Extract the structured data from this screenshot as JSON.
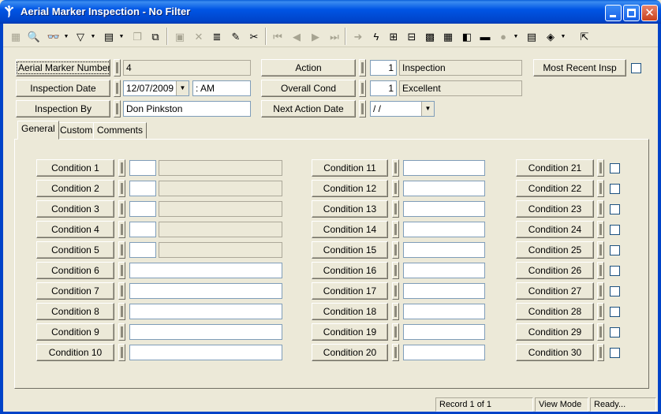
{
  "window": {
    "title": "Aerial Marker Inspection - No Filter"
  },
  "toolbar": {
    "icons": [
      "grid-icon",
      "preview-icon",
      "binoculars-icon",
      "filter-icon",
      "report-icon",
      "copy-icon",
      "export-icon",
      "save-icon",
      "delete-icon",
      "stack-icon",
      "edit-pencil-icon",
      "cut-icon",
      "first-record-icon",
      "prev-record-icon",
      "next-record-icon",
      "last-record-icon",
      "goto-icon",
      "lightning-icon",
      "tree-icon",
      "hierarchy-icon",
      "map-icon",
      "calculator-icon",
      "gis-icon",
      "cart-icon",
      "globe-icon",
      "list-icon",
      "book-icon",
      "exit-icon"
    ]
  },
  "header": {
    "aerial_marker_number": {
      "label": "Aerial Marker Number",
      "value": "4"
    },
    "inspection_date": {
      "label": "Inspection Date",
      "date": "12/07/2009",
      "time": " :  AM"
    },
    "inspection_by": {
      "label": "Inspection By",
      "value": "Don Pinkston"
    },
    "action": {
      "label": "Action",
      "code": "1",
      "value": "Inspection"
    },
    "overall_cond": {
      "label": "Overall Cond",
      "code": "1",
      "value": "Excellent"
    },
    "next_action_date": {
      "label": "Next Action Date",
      "value": " /  /"
    },
    "most_recent_insp": {
      "label": "Most Recent Insp",
      "checked": false
    }
  },
  "tabs": [
    {
      "label": "General",
      "active": true
    },
    {
      "label": "Custom",
      "active": false
    },
    {
      "label": "Comments",
      "active": false
    }
  ],
  "conditions": {
    "c1": "Condition 1",
    "c2": "Condition 2",
    "c3": "Condition 3",
    "c4": "Condition 4",
    "c5": "Condition 5",
    "c6": "Condition 6",
    "c7": "Condition 7",
    "c8": "Condition 8",
    "c9": "Condition 9",
    "c10": "Condition 10",
    "c11": "Condition 11",
    "c12": "Condition 12",
    "c13": "Condition 13",
    "c14": "Condition 14",
    "c15": "Condition 15",
    "c16": "Condition 16",
    "c17": "Condition 17",
    "c18": "Condition 18",
    "c19": "Condition 19",
    "c20": "Condition 20",
    "c21": "Condition 21",
    "c22": "Condition 22",
    "c23": "Condition 23",
    "c24": "Condition 24",
    "c25": "Condition 25",
    "c26": "Condition 26",
    "c27": "Condition 27",
    "c28": "Condition 28",
    "c29": "Condition 29",
    "c30": "Condition 30"
  },
  "statusbar": {
    "record": "Record 1 of 1",
    "mode": "View Mode",
    "state": "Ready..."
  }
}
